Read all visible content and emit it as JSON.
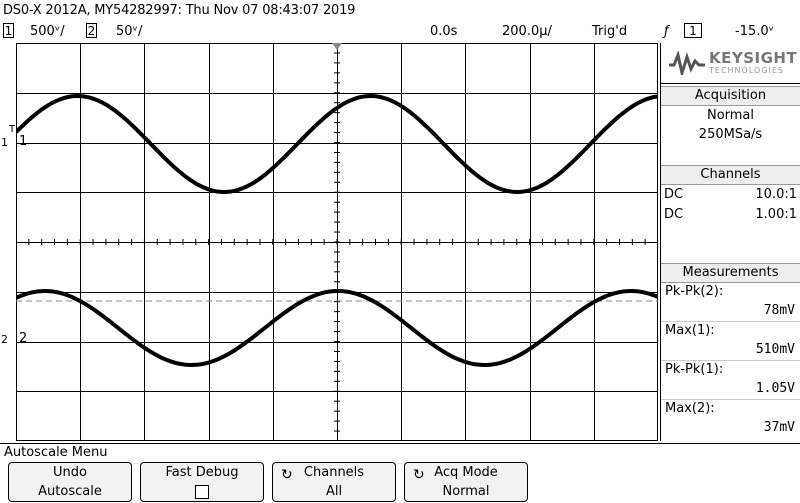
{
  "title": "DS0-X 2012A, MY54282997: Thu Nov 07 08:43:07 2019",
  "status": {
    "ch1_num": "1",
    "ch1_scale": "500ᵛ/",
    "ch2_num": "2",
    "ch2_scale": "50ᵛ/",
    "time_offset": "0.0s",
    "time_scale": "200.0µ/",
    "trig_status": "Trig'd",
    "trig_slope_icon": "rising-edge-icon",
    "trig_slope_glyph": "ƒ",
    "trig_source": "1",
    "trig_level": "-15.0ᵛ"
  },
  "markers": {
    "ch1_label": "1",
    "ch1_side": "1",
    "ch2_label": "2",
    "ch2_side": "2",
    "trigger_t": "T"
  },
  "panel": {
    "logo_brand": "KEYSIGHT",
    "logo_sub": "TECHNOLOGIES",
    "acquisition_title": "Acquisition",
    "acq_mode": "Normal",
    "sample_rate": "250MSa/s",
    "channels_title": "Channels",
    "channels": [
      {
        "coupling": "DC",
        "probe": "10.0:1"
      },
      {
        "coupling": "DC",
        "probe": "1.00:1"
      }
    ],
    "measurements_title": "Measurements",
    "measurements": [
      {
        "label": "Pk-Pk(2):",
        "value": "78mV"
      },
      {
        "label": "Max(1):",
        "value": "510mV"
      },
      {
        "label": "Pk-Pk(1):",
        "value": "1.05V"
      },
      {
        "label": "Max(2):",
        "value": "37mV"
      }
    ]
  },
  "menu": {
    "title": "Autoscale Menu",
    "softkeys": [
      {
        "line1": "Undo",
        "line2": "Autoscale"
      },
      {
        "line1": "Fast Debug",
        "line2": ""
      },
      {
        "line1": "Channels",
        "line2": "All"
      },
      {
        "line1": "Acq Mode",
        "line2": "Normal"
      }
    ]
  },
  "colors": {
    "trace": "#000000",
    "grid": "#000000",
    "background": "#ffffff"
  }
}
